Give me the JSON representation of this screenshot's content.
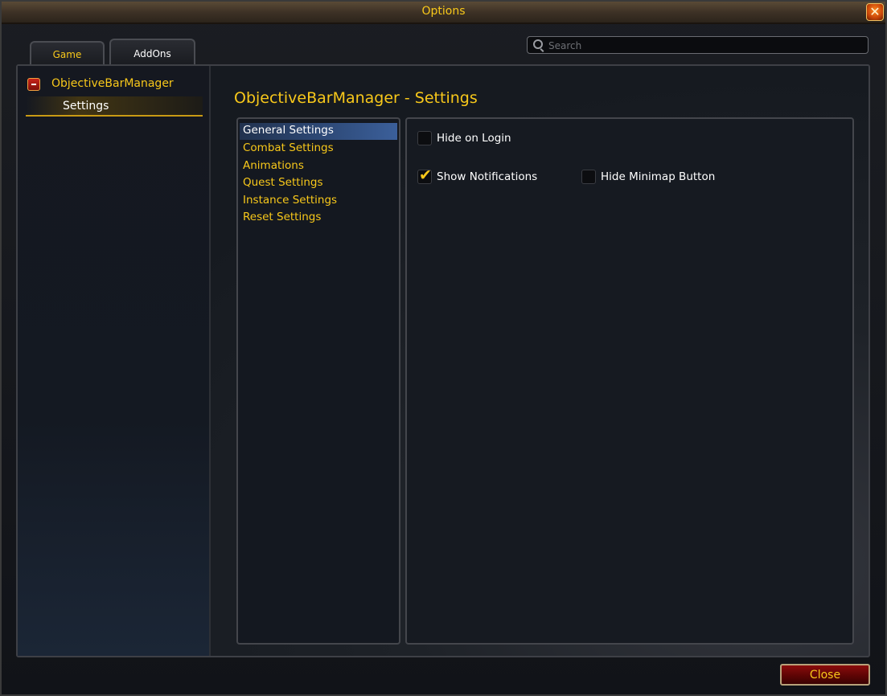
{
  "window": {
    "title": "Options"
  },
  "tabs": [
    {
      "label": "Game"
    },
    {
      "label": "AddOns"
    }
  ],
  "search": {
    "placeholder": "Search",
    "value": ""
  },
  "sidebar": {
    "addon": {
      "name": "ObjectiveBarManager",
      "icon": "collapse-minus-icon"
    },
    "items": [
      {
        "label": "Settings",
        "selected": true
      }
    ]
  },
  "main": {
    "title": "ObjectiveBarManager - Settings",
    "categories": [
      {
        "label": "General Settings",
        "selected": true
      },
      {
        "label": "Combat Settings"
      },
      {
        "label": "Animations"
      },
      {
        "label": "Quest Settings"
      },
      {
        "label": "Instance Settings"
      },
      {
        "label": "Reset Settings"
      }
    ],
    "options": [
      {
        "label": "Hide on Login",
        "checked": false
      },
      {
        "label": "Show Notifications",
        "checked": true
      },
      {
        "label": "Hide Minimap Button",
        "checked": false
      }
    ]
  },
  "footer": {
    "close_label": "Close"
  },
  "colors": {
    "accent_gold": "#f8c81a",
    "close_red": "#8a0c0c",
    "selection_blue": "#2e4a78"
  }
}
